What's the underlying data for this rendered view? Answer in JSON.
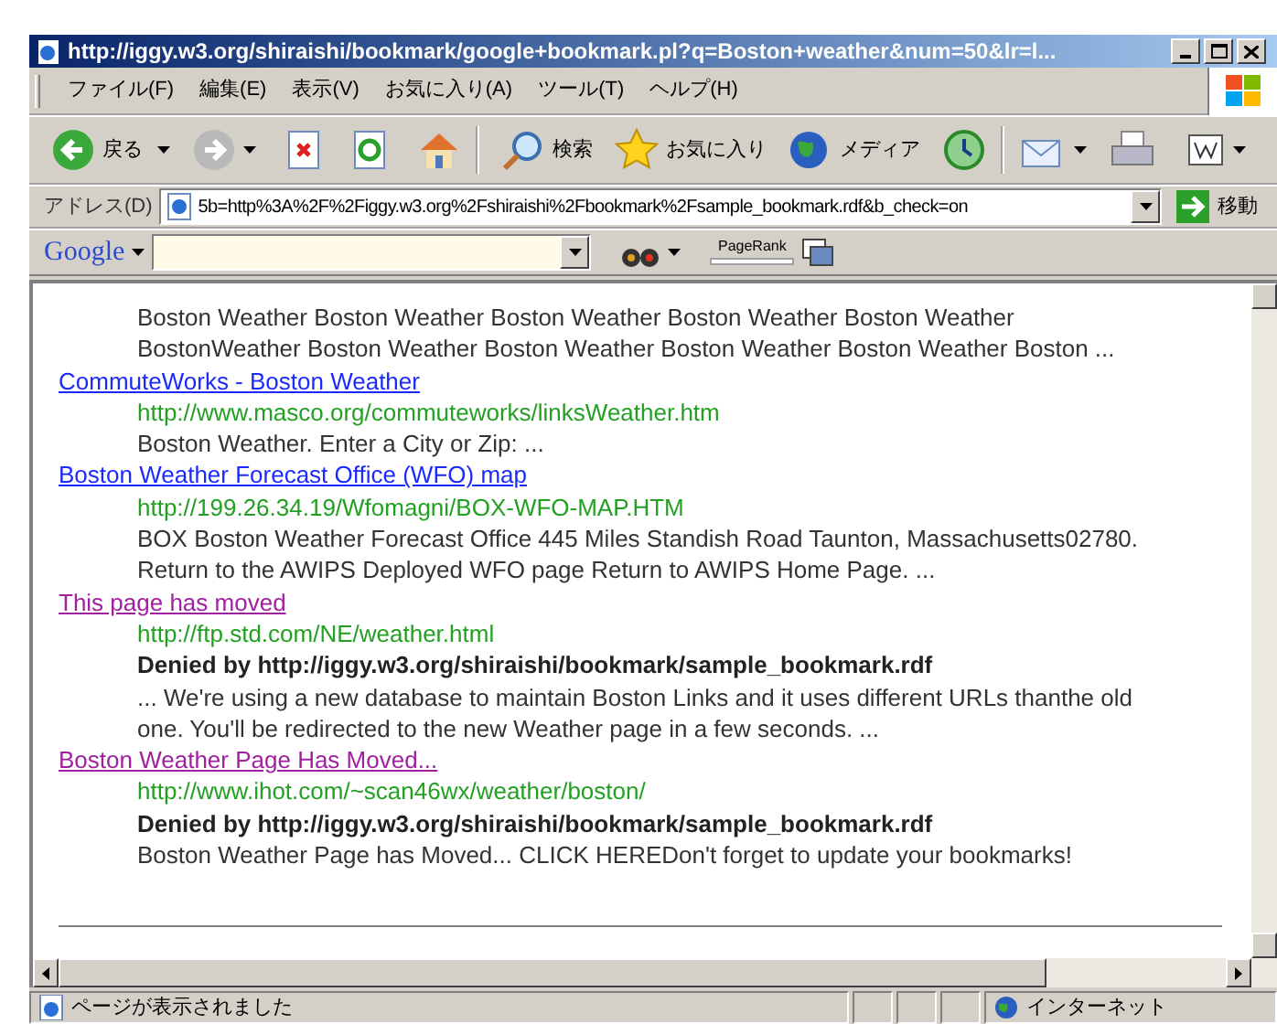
{
  "window": {
    "title": "http://iggy.w3.org/shiraishi/bookmark/google+bookmark.pl?q=Boston+weather&num=50&lr=l..."
  },
  "menu": [
    "ファイル(F)",
    "編集(E)",
    "表示(V)",
    "お気に入り(A)",
    "ツール(T)",
    "ヘルプ(H)"
  ],
  "toolbar": {
    "back": "戻る",
    "search": "検索",
    "favorites": "お気に入り",
    "media": "メディア"
  },
  "address_bar": {
    "label": "アドレス(D)",
    "value": "5b=http%3A%2F%2Figgy.w3.org%2Fshiraishi%2Fbookmark%2Fsample_bookmark.rdf&b_check=on",
    "go": "移動"
  },
  "google_bar": {
    "logo": "Google",
    "pagerank": "PageRank"
  },
  "results": [
    {
      "lines": [
        "Boston Weather Boston Weather Boston Weather Boston Weather Boston Weather",
        "BostonWeather Boston Weather Boston Weather Boston Weather Boston Weather Boston ..."
      ]
    },
    {
      "title": "CommuteWorks - Boston Weather",
      "visited": false,
      "url": "http://www.masco.org/commuteworks/linksWeather.htm",
      "lines": [
        "Boston Weather. Enter a City or Zip: ..."
      ]
    },
    {
      "title": "Boston Weather Forecast Office (WFO) map",
      "visited": false,
      "url": "http://199.26.34.19/Wfomagni/BOX-WFO-MAP.HTM",
      "lines": [
        "BOX Boston Weather Forecast Office 445 Miles Standish Road Taunton, Massachusetts02780.",
        "Return to the AWIPS Deployed WFO page Return to AWIPS Home Page. ..."
      ]
    },
    {
      "title": "This page has moved",
      "visited": true,
      "url": "http://ftp.std.com/NE/weather.html",
      "denied": "Denied by http://iggy.w3.org/shiraishi/bookmark/sample_bookmark.rdf",
      "lines": [
        "... We're using a new database to maintain Boston Links and it uses different URLs thanthe old",
        "one. You'll be redirected to the new Weather page in a few seconds. ..."
      ]
    },
    {
      "title": "Boston Weather Page Has Moved...",
      "visited": true,
      "url": "http://www.ihot.com/~scan46wx/weather/boston/",
      "denied": "Denied by http://iggy.w3.org/shiraishi/bookmark/sample_bookmark.rdf",
      "lines": [
        "Boston Weather Page has Moved... CLICK HEREDon't forget to update your bookmarks!"
      ]
    }
  ],
  "status_bar": {
    "message": "ページが表示されました",
    "zone": "インターネット"
  }
}
